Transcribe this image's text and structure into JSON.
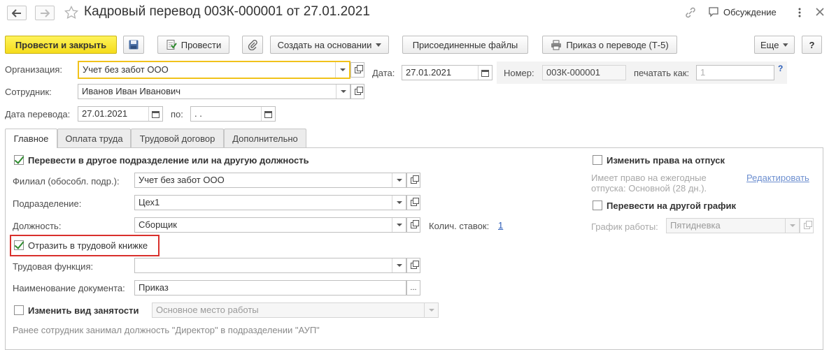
{
  "header": {
    "title": "Кадровый перевод 003К-000001 от 27.01.2021",
    "discussion_label": "Обсуждение"
  },
  "toolbar": {
    "post_and_close": "Провести и закрыть",
    "post": "Провести",
    "create_based_on": "Создать на основании",
    "attached_files": "Присоединенные файлы",
    "print_order": "Приказ о переводе (Т-5)",
    "more": "Еще",
    "help": "?"
  },
  "form": {
    "organization_label": "Организация:",
    "organization_value": "Учет без забот ООО",
    "date_label": "Дата:",
    "date_value": "27.01.2021",
    "number_label": "Номер:",
    "number_value": "003К-000001",
    "print_as_label": "печатать как:",
    "print_as_value": "1",
    "print_as_help": "?",
    "employee_label": "Сотрудник:",
    "employee_value": "Иванов Иван Иванович",
    "transfer_date_label": "Дата перевода:",
    "transfer_date_value": "27.01.2021",
    "to_label": "по:",
    "to_value": " .  ."
  },
  "tabs": [
    {
      "label": "Главное",
      "active": true
    },
    {
      "label": "Оплата труда",
      "active": false
    },
    {
      "label": "Трудовой договор",
      "active": false
    },
    {
      "label": "Дополнительно",
      "active": false
    }
  ],
  "main": {
    "transfer_checkbox_label": "Перевести в другое подразделение или на другую должность",
    "transfer_checked": true,
    "branch_label": "Филиал (обособл. подр.):",
    "branch_value": "Учет без забот ООО",
    "department_label": "Подразделение:",
    "department_value": "Цех1",
    "position_label": "Должность:",
    "position_value": "Сборщик",
    "rates_label": "Колич. ставок:",
    "rates_value": "1",
    "workbook_checkbox_label": "Отразить в трудовой книжке",
    "workbook_checked": true,
    "labor_function_label": "Трудовая функция:",
    "labor_function_value": "",
    "doc_name_label": "Наименование документа:",
    "doc_name_value": "Приказ",
    "doc_name_btn": "...",
    "employment_type_label": "Изменить вид занятости",
    "employment_type_checked": false,
    "employment_type_value": "Основное место работы",
    "previous_note": "Ранее сотрудник занимал должность \"Директор\" в подразделении \"АУП\""
  },
  "right": {
    "vacation_rights_label": "Изменить права на отпуск",
    "vacation_rights_checked": false,
    "vacation_info_line1": "Имеет право на ежегодные",
    "vacation_info_line2": "отпуска: Основной (28 дн.).",
    "edit_link": "Редактировать",
    "schedule_label": "Перевести на другой график",
    "schedule_checked": false,
    "work_schedule_label": "График работы:",
    "work_schedule_value": "Пятидневка"
  },
  "colors": {
    "primary_button": "#f5dc1b",
    "highlight_frame": "#d9302c",
    "link": "#2b5cb8",
    "check": "#2e8b2e"
  }
}
